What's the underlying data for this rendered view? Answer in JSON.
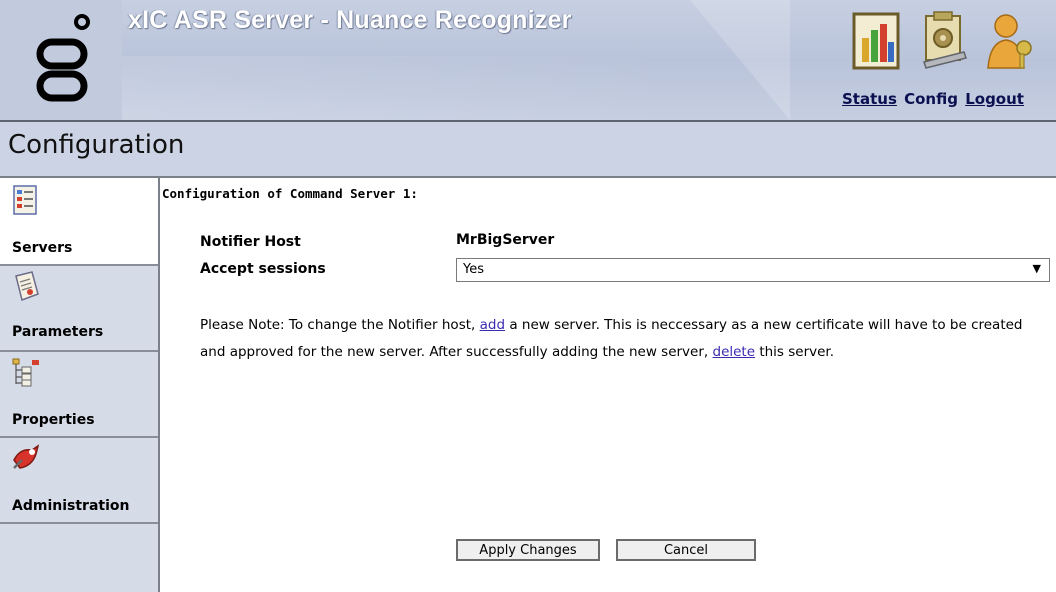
{
  "header": {
    "title": "xIC ASR Server - Nuance Recognizer",
    "links": {
      "status": "Status",
      "config": "Config",
      "logout": "Logout"
    },
    "icons": [
      "status-chart-icon",
      "config-clipboard-icon",
      "logout-user-key-icon"
    ]
  },
  "page": {
    "title": "Configuration"
  },
  "sidebar": {
    "items": [
      {
        "label": "Servers",
        "icon": "servers-checklist-icon",
        "active": true
      },
      {
        "label": "Parameters",
        "icon": "parameters-document-icon",
        "active": false
      },
      {
        "label": "Properties",
        "icon": "properties-tree-icon",
        "active": false
      },
      {
        "label": "Administration",
        "icon": "administration-tools-icon",
        "active": false
      }
    ]
  },
  "main": {
    "heading": "Configuration of Command Server 1:",
    "fields": {
      "notifier_host_label": "Notifier Host",
      "notifier_host_value": "MrBigServer",
      "accept_sessions_label": "Accept sessions",
      "accept_sessions_value": "Yes"
    },
    "note": {
      "part1": "Please Note: To change the Notifier host, ",
      "link_add": "add",
      "part2": " a new server. This is neccessary as a new certificate will have to be created and approved for the new server. After successfully adding the new server, ",
      "link_delete": "delete",
      "part3": " this server."
    },
    "buttons": {
      "apply": "Apply Changes",
      "cancel": "Cancel"
    }
  },
  "colors": {
    "header_bg": "#c7d0e2",
    "sidebar_bg": "#d6dbe8",
    "link": "#3b2bb3",
    "title_text": "#ffffff"
  }
}
